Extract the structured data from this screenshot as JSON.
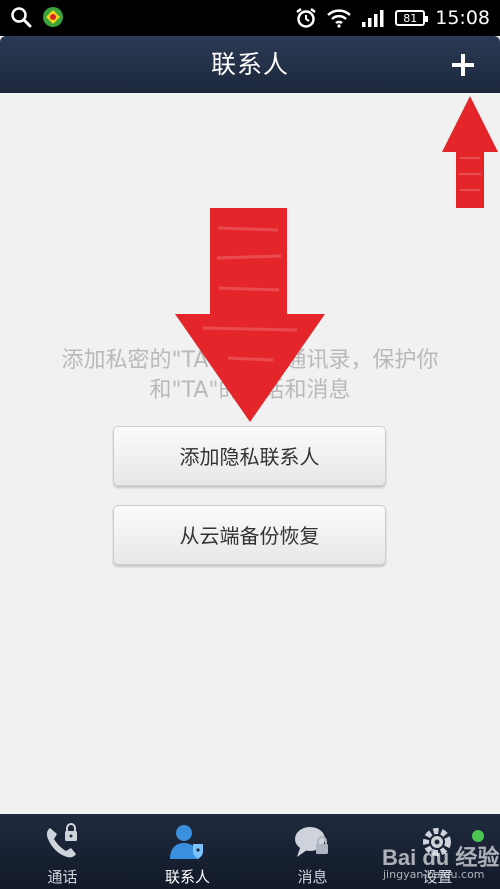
{
  "status_bar": {
    "time": "15:08",
    "battery": "81",
    "icons": [
      "search-icon",
      "app-icon",
      "alarm-icon",
      "wifi-icon",
      "signal-icon",
      "battery-icon"
    ]
  },
  "header": {
    "title": "联系人",
    "add_icon": "plus-icon"
  },
  "content": {
    "hint_line1": "添加私密的\"TA\"到隐私通讯录，保护你",
    "hint_line2": "和\"TA\"的通话和消息",
    "add_private_contact": "添加隐私联系人",
    "restore_from_cloud": "从云端备份恢复"
  },
  "tabs": [
    {
      "label": "通话",
      "icon": "phone-lock-icon",
      "active": false
    },
    {
      "label": "联系人",
      "icon": "contact-lock-icon",
      "active": true
    },
    {
      "label": "消息",
      "icon": "message-lock-icon",
      "active": false
    },
    {
      "label": "设置",
      "icon": "gear-lock-icon",
      "active": false
    }
  ],
  "watermark": {
    "brand": "Bai du 经验",
    "url": "jingyan.baidu.com"
  },
  "colors": {
    "header_bg": "#1f2a3f",
    "annotation_arrow": "#e4262b",
    "active_tab_icon": "#3a8fde",
    "notification_dot": "#4cc552"
  }
}
